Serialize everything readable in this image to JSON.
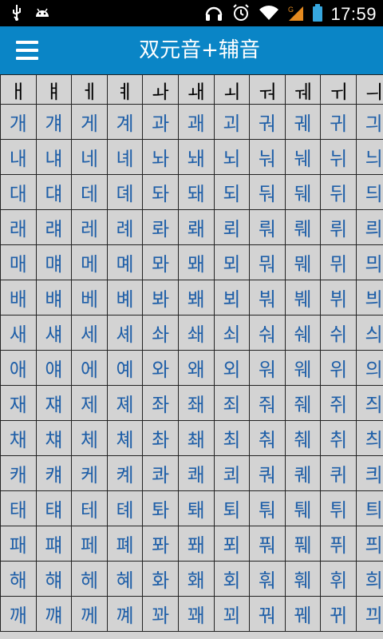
{
  "status_bar": {
    "left_icons": [
      "usb-icon",
      "android-icon"
    ],
    "right_icons": [
      "headset-icon",
      "alarm-icon",
      "wifi-icon",
      "signal-icon",
      "battery-icon"
    ],
    "time": "17:59"
  },
  "app_bar": {
    "menu_icon": "hamburger-menu-icon",
    "title": "双元音+辅音"
  },
  "grid": {
    "header": [
      "ㅐ",
      "ㅒ",
      "ㅔ",
      "ㅖ",
      "ㅘ",
      "ㅙ",
      "ㅚ",
      "ㅝ",
      "ㅞ",
      "ㅟ",
      "ㅢ"
    ],
    "rows": [
      [
        "개",
        "걔",
        "게",
        "계",
        "과",
        "괘",
        "괴",
        "궈",
        "궤",
        "귀",
        "긔"
      ],
      [
        "내",
        "냬",
        "네",
        "녜",
        "놔",
        "놰",
        "뇌",
        "눠",
        "눼",
        "뉘",
        "늬"
      ],
      [
        "대",
        "댸",
        "데",
        "뎨",
        "돠",
        "돼",
        "되",
        "둬",
        "뒈",
        "뒤",
        "듸"
      ],
      [
        "래",
        "럐",
        "레",
        "례",
        "롸",
        "뢔",
        "뢰",
        "뤄",
        "뤠",
        "뤼",
        "릐"
      ],
      [
        "매",
        "먜",
        "메",
        "몌",
        "뫄",
        "뫠",
        "뫼",
        "뭐",
        "뭬",
        "뮈",
        "믜"
      ],
      [
        "배",
        "뱨",
        "베",
        "볘",
        "봐",
        "봬",
        "뵈",
        "붜",
        "붸",
        "뷔",
        "븨"
      ],
      [
        "새",
        "섀",
        "세",
        "셰",
        "솨",
        "쇄",
        "쇠",
        "숴",
        "쉐",
        "쉬",
        "싀"
      ],
      [
        "애",
        "얘",
        "에",
        "예",
        "와",
        "왜",
        "외",
        "워",
        "웨",
        "위",
        "의"
      ],
      [
        "재",
        "쟤",
        "제",
        "졔",
        "좌",
        "좨",
        "죄",
        "줘",
        "줴",
        "쥐",
        "즤"
      ],
      [
        "채",
        "챼",
        "체",
        "쳬",
        "촤",
        "쵀",
        "최",
        "춰",
        "췌",
        "취",
        "츼"
      ],
      [
        "캐",
        "컈",
        "케",
        "켸",
        "콰",
        "쾌",
        "쾨",
        "쿼",
        "퀘",
        "퀴",
        "킈"
      ],
      [
        "태",
        "턔",
        "테",
        "톄",
        "톼",
        "퇘",
        "퇴",
        "퉈",
        "퉤",
        "튀",
        "틔"
      ],
      [
        "패",
        "퍠",
        "페",
        "폐",
        "퐈",
        "퐤",
        "푀",
        "풔",
        "풰",
        "퓌",
        "픠"
      ],
      [
        "해",
        "햬",
        "헤",
        "혜",
        "화",
        "홰",
        "회",
        "훠",
        "훼",
        "휘",
        "희"
      ],
      [
        "깨",
        "꺠",
        "께",
        "꼐",
        "꽈",
        "꽤",
        "꾀",
        "꿔",
        "꿰",
        "뀌",
        "끠"
      ]
    ]
  }
}
